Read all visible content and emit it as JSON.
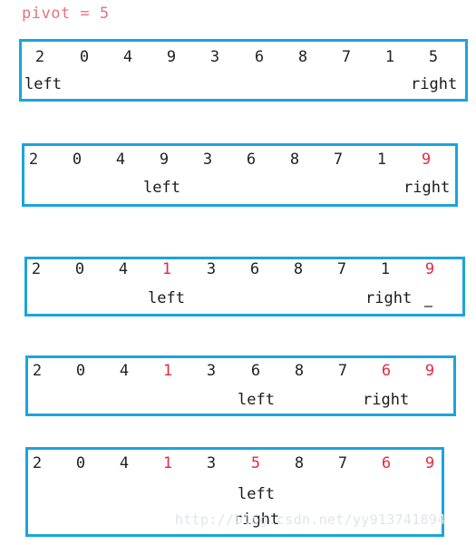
{
  "title": "pivot = 5",
  "colors": {
    "border": "#1ba4dd",
    "highlight": "#e8293f",
    "title": "#e8717f",
    "digit": "#222222",
    "watermark": "#dfe6ea"
  },
  "labels": {
    "left": "left",
    "right": "right"
  },
  "watermark": "http://blog.csdn.net/yy913741894",
  "steps": [
    {
      "name": "step-1",
      "values": [
        "2",
        "0",
        "4",
        "9",
        "3",
        "6",
        "8",
        "7",
        "1",
        "5"
      ],
      "highlighted": [],
      "left_index": 0,
      "right_index": 9
    },
    {
      "name": "step-2",
      "values": [
        "2",
        "0",
        "4",
        "9",
        "3",
        "6",
        "8",
        "7",
        "1",
        "9"
      ],
      "highlighted": [
        9
      ],
      "left_index": 3,
      "right_index": 9
    },
    {
      "name": "step-3",
      "values": [
        "2",
        "0",
        "4",
        "1",
        "3",
        "6",
        "8",
        "7",
        "1",
        "9"
      ],
      "highlighted": [
        3,
        9
      ],
      "left_index": 3,
      "right_index": 8
    },
    {
      "name": "step-4",
      "values": [
        "2",
        "0",
        "4",
        "1",
        "3",
        "6",
        "8",
        "7",
        "6",
        "9"
      ],
      "highlighted": [
        3,
        8,
        9
      ],
      "left_index": 5,
      "right_index": 8
    },
    {
      "name": "step-5",
      "values": [
        "2",
        "0",
        "4",
        "1",
        "3",
        "5",
        "8",
        "7",
        "6",
        "9"
      ],
      "highlighted": [
        3,
        5,
        8,
        9
      ],
      "left_index": 5,
      "right_index": 5
    }
  ]
}
